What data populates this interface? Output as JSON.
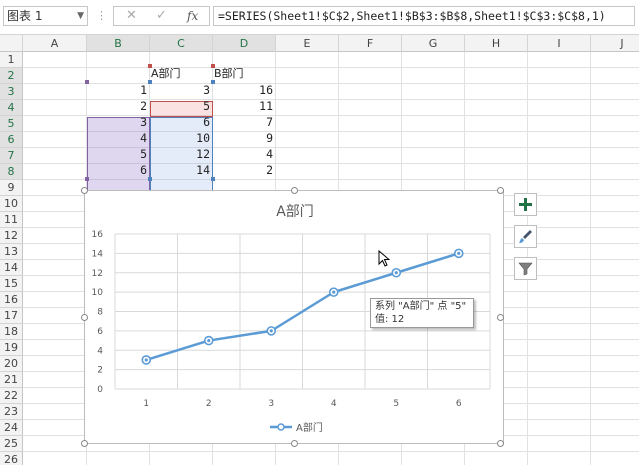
{
  "name_box": "图表 1",
  "formula_bar": {
    "more": "⋮",
    "cancel_icon": "✕",
    "enter_icon": "✓",
    "fx_label": "fx",
    "formula": "=SERIES(Sheet1!$C$2,Sheet1!$B$3:$B$8,Sheet1!$C$3:$C$8,1)"
  },
  "columns": [
    "A",
    "B",
    "C",
    "D",
    "E",
    "F",
    "G",
    "H",
    "I",
    "J"
  ],
  "rows": [
    "1",
    "2",
    "3",
    "4",
    "5",
    "6",
    "7",
    "8",
    "9",
    "10",
    "11",
    "12",
    "13",
    "14",
    "15",
    "16",
    "17",
    "18",
    "19",
    "20",
    "21",
    "22",
    "23",
    "24",
    "25",
    "26"
  ],
  "sheet": {
    "headers": {
      "c": "A部门",
      "d": "B部门"
    },
    "b": [
      "1",
      "2",
      "3",
      "4",
      "5",
      "6"
    ],
    "c": [
      "3",
      "5",
      "6",
      "10",
      "12",
      "14"
    ],
    "d": [
      "16",
      "11",
      "7",
      "9",
      "4",
      "2"
    ]
  },
  "chart_data": {
    "type": "line",
    "title": "A部门",
    "categories": [
      "1",
      "2",
      "3",
      "4",
      "5",
      "6"
    ],
    "series": [
      {
        "name": "A部门",
        "values": [
          3,
          5,
          6,
          10,
          12,
          14
        ],
        "color": "#5b9bd5"
      }
    ],
    "ylim": [
      0,
      16
    ],
    "yticks": [
      "0",
      "2",
      "4",
      "6",
      "8",
      "10",
      "12",
      "14",
      "16"
    ],
    "grid": true,
    "legend": "bottom"
  },
  "tooltip": {
    "line1": "系列 \"A部门\" 点 \"5\"",
    "line2": "值: 12"
  },
  "side_buttons": {
    "add_icon": "plus-icon",
    "style_icon": "brush-icon",
    "filter_icon": "funnel-icon",
    "accent": "#217346"
  }
}
